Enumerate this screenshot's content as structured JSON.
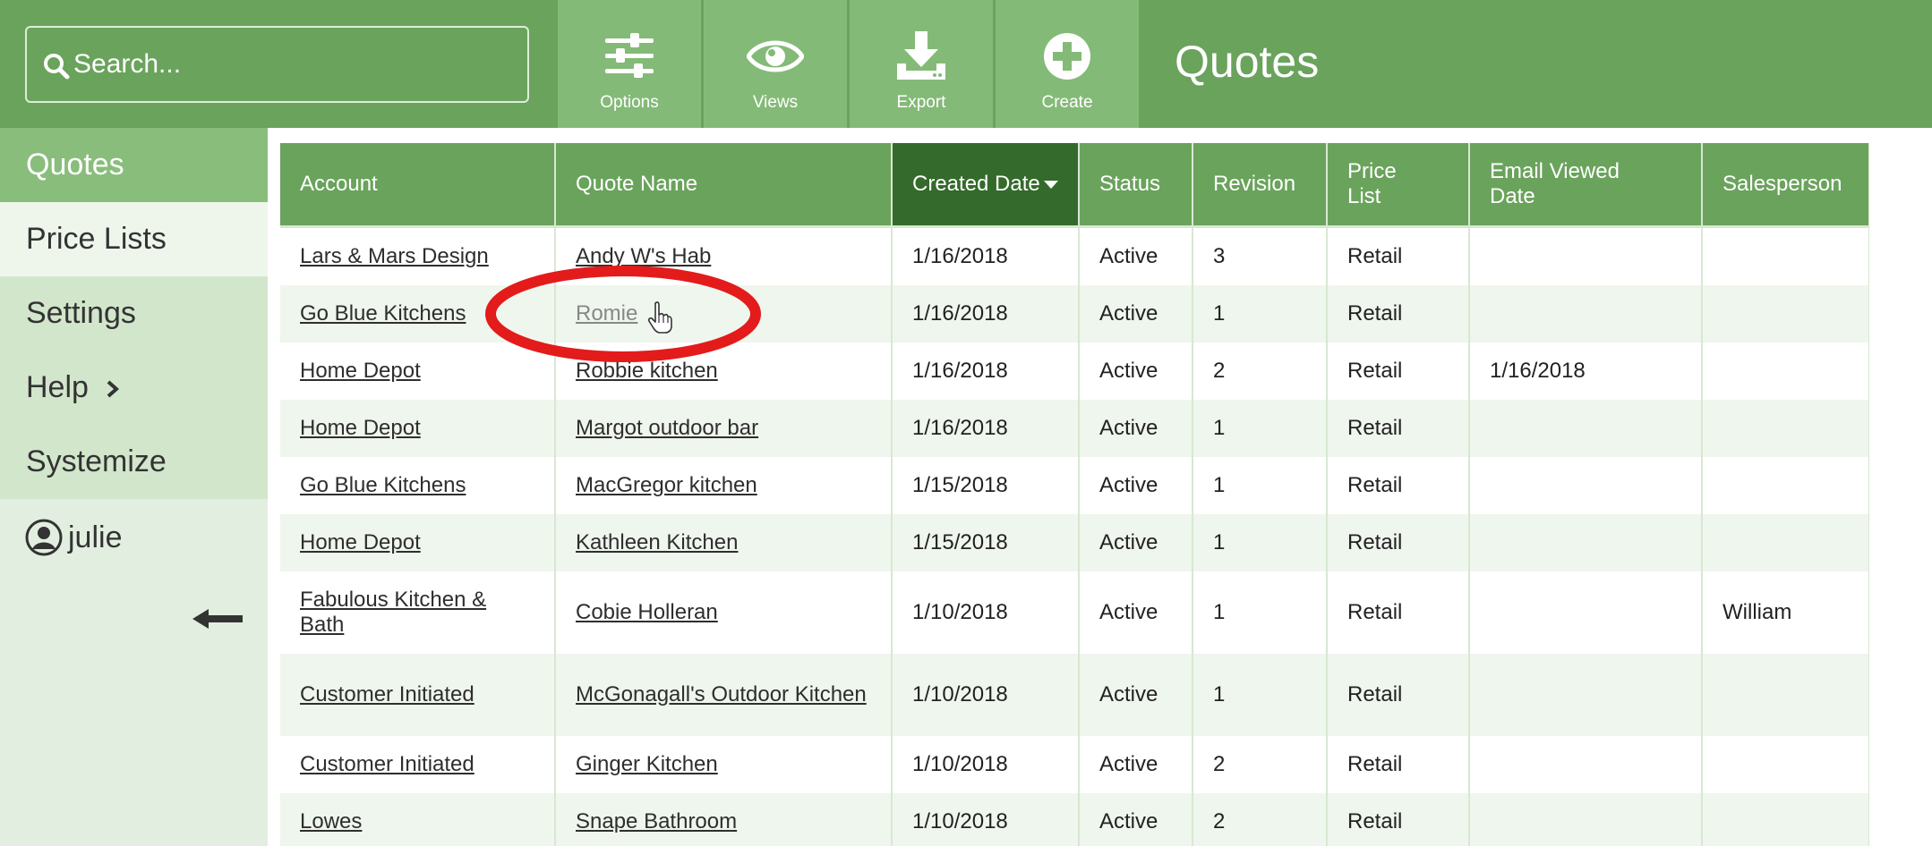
{
  "search": {
    "placeholder": "Search..."
  },
  "toolbar": {
    "buttons": [
      {
        "label": "Options",
        "icon": "sliders-icon"
      },
      {
        "label": "Views",
        "icon": "eye-icon"
      },
      {
        "label": "Export",
        "icon": "download-icon"
      },
      {
        "label": "Create",
        "icon": "plus-circle-icon"
      }
    ]
  },
  "page": {
    "title": "Quotes"
  },
  "sidebar": {
    "items": [
      {
        "label": "Quotes",
        "active": true
      },
      {
        "label": "Price Lists"
      },
      {
        "label": "Settings"
      },
      {
        "label": "Help"
      },
      {
        "label": "Systemize"
      }
    ],
    "user": {
      "name": "julie",
      "icon": "user-circle-icon"
    },
    "collapse_icon": "arrow-left-icon"
  },
  "table": {
    "columns": [
      "Account",
      "Quote Name",
      "Created Date",
      "Status",
      "Revision",
      "Price List",
      "Email Viewed Date",
      "Salesperson"
    ],
    "sorted_column": "Created Date",
    "sort_direction": "descending",
    "rows": [
      {
        "account": "Lars & Mars Design",
        "quote_name": "Andy W's Hab",
        "created_date": "1/16/2018",
        "status": "Active",
        "revision": "3",
        "price_list": "Retail",
        "email_viewed_date": "",
        "salesperson": ""
      },
      {
        "account": "Go Blue Kitchens",
        "quote_name": "Romie",
        "created_date": "1/16/2018",
        "status": "Active",
        "revision": "1",
        "price_list": "Retail",
        "email_viewed_date": "",
        "salesperson": ""
      },
      {
        "account": "Home Depot",
        "quote_name": "Robbie kitchen",
        "created_date": "1/16/2018",
        "status": "Active",
        "revision": "2",
        "price_list": "Retail",
        "email_viewed_date": "1/16/2018",
        "salesperson": ""
      },
      {
        "account": "Home Depot",
        "quote_name": "Margot outdoor bar",
        "created_date": "1/16/2018",
        "status": "Active",
        "revision": "1",
        "price_list": "Retail",
        "email_viewed_date": "",
        "salesperson": ""
      },
      {
        "account": "Go Blue Kitchens",
        "quote_name": "MacGregor kitchen",
        "created_date": "1/15/2018",
        "status": "Active",
        "revision": "1",
        "price_list": "Retail",
        "email_viewed_date": "",
        "salesperson": ""
      },
      {
        "account": "Home Depot",
        "quote_name": "Kathleen Kitchen",
        "created_date": "1/15/2018",
        "status": "Active",
        "revision": "1",
        "price_list": "Retail",
        "email_viewed_date": "",
        "salesperson": ""
      },
      {
        "account": "Fabulous Kitchen & Bath",
        "quote_name": "Cobie Holleran",
        "created_date": "1/10/2018",
        "status": "Active",
        "revision": "1",
        "price_list": "Retail",
        "email_viewed_date": "",
        "salesperson": "William"
      },
      {
        "account": "Customer Initiated",
        "quote_name": "McGonagall's Outdoor Kitchen",
        "created_date": "1/10/2018",
        "status": "Active",
        "revision": "1",
        "price_list": "Retail",
        "email_viewed_date": "",
        "salesperson": ""
      },
      {
        "account": "Customer Initiated",
        "quote_name": "Ginger Kitchen",
        "created_date": "1/10/2018",
        "status": "Active",
        "revision": "2",
        "price_list": "Retail",
        "email_viewed_date": "",
        "salesperson": ""
      },
      {
        "account": "Lowes",
        "quote_name": "Snape Bathroom",
        "created_date": "1/10/2018",
        "status": "Active",
        "revision": "2",
        "price_list": "Retail",
        "email_viewed_date": "",
        "salesperson": ""
      }
    ]
  },
  "annotation": {
    "highlight_color": "#e31b1b",
    "highlighted_quote": "Romie"
  },
  "colors": {
    "brand_green": "#6aa35c",
    "toolbar_button": "#84ba77",
    "sorted_header": "#346a2b",
    "sidebar_active": "#89bd7b"
  }
}
